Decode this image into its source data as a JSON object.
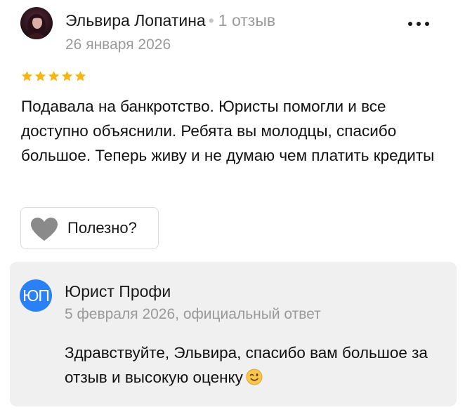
{
  "review": {
    "author_name": "Эльвира Лопатина",
    "separator": "•",
    "author_review_count": "1 отзыв",
    "date": "26 января 2026",
    "rating": 5,
    "text": "Подавала на банкротство. Юристы помогли и все доступно объяснили. Ребята вы молодцы, спасибо большое. Теперь живу и не думаю чем платить кредиты",
    "useful_label": "Полезно?",
    "more_icon": "more-dots-icon"
  },
  "reply": {
    "avatar_initials": "ЮП",
    "author_name": "Юрист Профи",
    "meta": "5 февраля 2026, официальный ответ",
    "text": "Здравствуйте, Эльвира, спасибо вам большое за отзыв и высокую оценку",
    "emoji": "winking-face-icon"
  },
  "colors": {
    "star": "#f5b512",
    "reply_avatar": "#2a81f7",
    "reply_background": "#f0f0f0",
    "muted_text": "#9a9a9a",
    "heart": "#8a8a8a"
  }
}
